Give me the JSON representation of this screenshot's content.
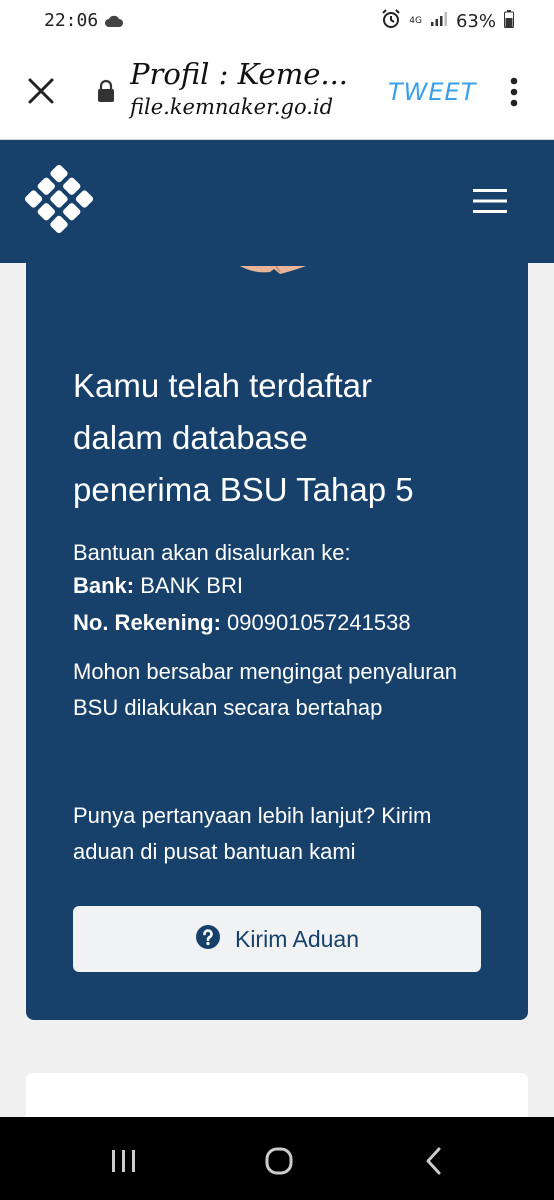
{
  "status_bar": {
    "time": "22:06",
    "network": "4G",
    "battery": "63%"
  },
  "browser": {
    "title": "Profil : Keme...",
    "domain": "file.kemnaker.go.id",
    "tweet_label": "TWEET"
  },
  "card": {
    "heading_lines": [
      "Kamu telah terdaftar",
      "dalam database",
      "penerima BSU Tahap 5"
    ],
    "intro": "Bantuan akan disalurkan ke:",
    "bank_label": "Bank:",
    "bank_value": "BANK BRI",
    "account_label": "No. Rekening:",
    "account_value": "090901057241538",
    "notice": "Mohon bersabar mengingat penyaluran BSU dilakukan secara bertahap",
    "question": "Punya pertanyaan lebih lanjut? Kirim aduan di pusat bantuan kami",
    "button_label": "Kirim Aduan"
  },
  "colors": {
    "brand_navy": "#17416b",
    "tweet_blue": "#3aa0e8",
    "button_bg": "#f1f2f4"
  },
  "icons": {
    "status": [
      "cloud-icon",
      "alarm-icon",
      "signal-icon",
      "battery-icon"
    ],
    "browser": [
      "close-icon",
      "lock-icon",
      "more-vert-icon"
    ],
    "site": [
      "kemnaker-logo-icon",
      "hamburger-menu-icon"
    ],
    "card": [
      "question-circle-icon"
    ],
    "nav": [
      "recent-apps-icon",
      "home-icon",
      "back-icon"
    ]
  }
}
